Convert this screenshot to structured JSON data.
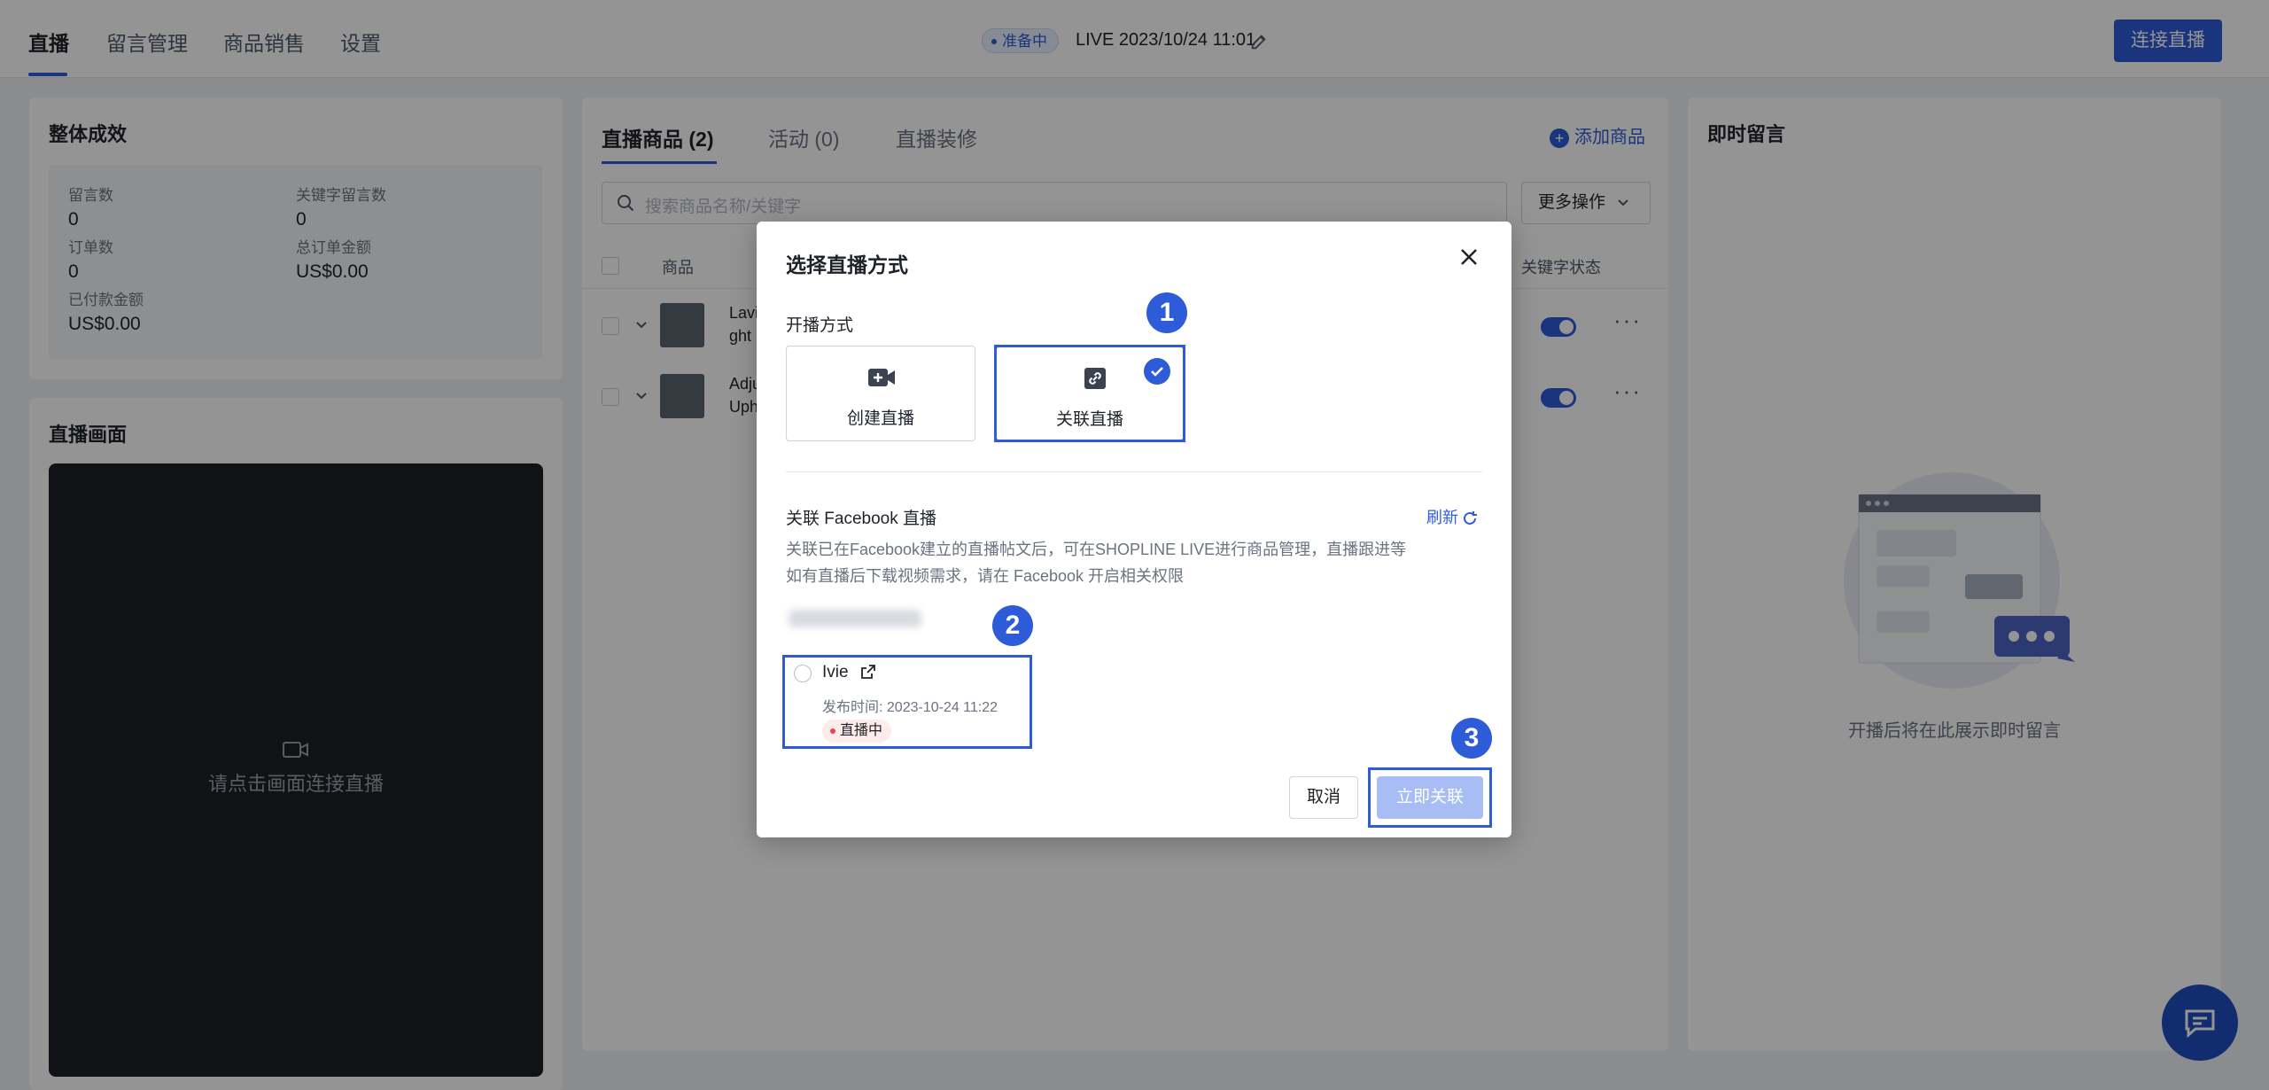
{
  "nav": {
    "tabs": [
      "直播",
      "留言管理",
      "商品销售",
      "设置"
    ],
    "status_badge": "准备中",
    "live_title": "LIVE 2023/10/24 11:01",
    "connect_button": "连接直播"
  },
  "overall": {
    "title": "整体成效",
    "stats": [
      {
        "label": "留言数",
        "value": "0"
      },
      {
        "label": "关键字留言数",
        "value": "0"
      },
      {
        "label": "订单数",
        "value": "0"
      },
      {
        "label": "总订单金额",
        "value": "US$0.00"
      },
      {
        "label": "已付款金额",
        "value": "US$0.00"
      }
    ]
  },
  "live_screen": {
    "title": "直播画面",
    "hint": "请点击画面连接直播"
  },
  "products": {
    "tabs": [
      "直播商品 (2)",
      "活动 (0)",
      "直播装修"
    ],
    "add_button": "添加商品",
    "search_placeholder": "搜索商品名称/关键字",
    "more_actions": "更多操作",
    "columns": {
      "product": "商品",
      "keyword_status": "关键字状态"
    },
    "rows": [
      {
        "name_line1": "Lavi",
        "name_line2": "ght"
      },
      {
        "name_line1": "Adju",
        "name_line2": "Uph"
      }
    ]
  },
  "comments": {
    "title": "即时留言",
    "empty_text": "开播后将在此展示即时留言"
  },
  "modal": {
    "title": "选择直播方式",
    "section_label": "开播方式",
    "modes": [
      {
        "label": "创建直播",
        "icon": "video-plus-icon"
      },
      {
        "label": "关联直播",
        "icon": "link-icon"
      }
    ],
    "fb_label": "关联 Facebook 直播",
    "refresh": "刷新",
    "desc_line1": "关联已在Facebook建立的直播帖文后，可在SHOPLINE LIVE进行商品管理，直播跟进等",
    "desc_line2": "如有直播后下载视频需求，请在 Facebook 开启相关权限",
    "live_item": {
      "name": "Ivie",
      "publish_time": "发布时间: 2023-10-24 11:22",
      "tag": "直播中"
    },
    "cancel": "取消",
    "confirm": "立即关联"
  },
  "markers": [
    "1",
    "2",
    "3"
  ],
  "colors": {
    "accent": "#2e5bd8",
    "dark_video": "#1d2026",
    "live_red": "#e5484d"
  }
}
